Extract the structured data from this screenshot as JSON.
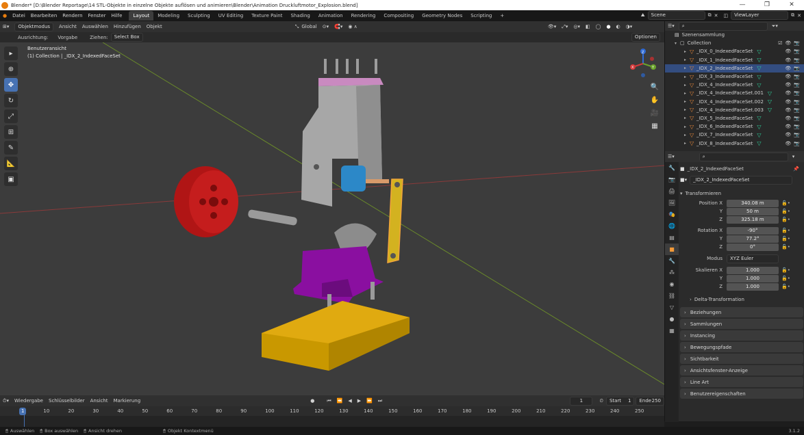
{
  "window": {
    "title": "Blender* [D:\\Blender Reportage\\14 STL-Objekte in einzelne Objekte auflösen und animieren\\Blender\\Animation Druckluftmotor_Explosion.blend]",
    "min_icon": "minimize-icon",
    "max_icon": "maximize-icon",
    "close_icon": "close-icon"
  },
  "menu": {
    "items": [
      "Datei",
      "Bearbeiten",
      "Rendern",
      "Fenster",
      "Hilfe"
    ],
    "workspaces": [
      "Layout",
      "Modeling",
      "Sculpting",
      "UV Editing",
      "Texture Paint",
      "Shading",
      "Animation",
      "Rendering",
      "Compositing",
      "Geometry Nodes",
      "Scripting",
      "+"
    ],
    "active_workspace": "Layout",
    "scene_label": "Scene",
    "viewlayer_label": "ViewLayer"
  },
  "viewport_header": {
    "mode": "Objektmodus",
    "items": [
      "Ansicht",
      "Auswählen",
      "Hinzufügen",
      "Objekt"
    ],
    "transform_orientation": "Global",
    "options": "Optionen"
  },
  "tool_header": {
    "orientation_label": "Ausrichtung:",
    "orientation_value": "Vorgabe",
    "drag_label": "Ziehen:",
    "drag_value": "Select Box"
  },
  "viewport": {
    "view_name": "Benutzeransicht",
    "object_info": "(1) Collection | _IDX_2_IndexedFaceSet",
    "gizmo_axes": [
      "X",
      "Y",
      "Z"
    ]
  },
  "toolbar": {
    "tools": [
      "select-box-icon",
      "cursor-icon",
      "move-icon",
      "rotate-icon",
      "scale-icon",
      "transform-icon",
      "annotate-icon",
      "measure-icon",
      "add-cube-icon"
    ],
    "active_index": 2
  },
  "outliner": {
    "root": "Szenensammlung",
    "collection": "Collection",
    "items": [
      "_IDX_0_IndexedFaceSet",
      "_IDX_1_IndexedFaceSet",
      "_IDX_2_IndexedFaceSet",
      "_IDX_3_IndexedFaceSet",
      "_IDX_4_IndexedFaceSet",
      "_IDX_4_IndexedFaceSet.001",
      "_IDX_4_IndexedFaceSet.002",
      "_IDX_4_IndexedFaceSet.003",
      "_IDX_5_IndexedFaceSet",
      "_IDX_6_IndexedFaceSet",
      "_IDX_7_IndexedFaceSet",
      "_IDX_8_IndexedFaceSet"
    ],
    "selected_index": 2
  },
  "properties": {
    "object_name": "_IDX_2_IndexedFaceSet",
    "object_field": "_IDX_2_IndexedFaceSet",
    "section": "Transformieren",
    "position_label": "Position X",
    "position": [
      "340.08 m",
      "50 m",
      "325.18 m"
    ],
    "rotation_label": "Rotation X",
    "rotation": [
      "-90°",
      "77.2°",
      "0°"
    ],
    "mode_label": "Modus",
    "mode_value": "XYZ Euler",
    "scale_label": "Skalieren X",
    "scale": [
      "1.000",
      "1.000",
      "1.000"
    ],
    "y": "Y",
    "z": "Z",
    "delta": "Delta-Transformation",
    "panels": [
      "Beziehungen",
      "Sammlungen",
      "Instancing",
      "Bewegungspfade",
      "Sichtbarkeit",
      "Ansichtsfenster-Anzeige",
      "Line Art",
      "Benutzereigenschaften"
    ]
  },
  "timeline": {
    "menu": [
      "Wiedergabe",
      "Schlüsselbilder",
      "Ansicht",
      "Markierung"
    ],
    "current_frame": "1",
    "start_label": "Start",
    "start_value": "1",
    "end_label": "Ende",
    "end_value": "250",
    "ticks": [
      "1",
      "10",
      "20",
      "30",
      "40",
      "50",
      "60",
      "70",
      "80",
      "90",
      "100",
      "110",
      "120",
      "130",
      "140",
      "150",
      "160",
      "170",
      "180",
      "190",
      "200",
      "210",
      "220",
      "230",
      "240",
      "250"
    ],
    "playhead": "1"
  },
  "statusbar": {
    "select": "Auswählen",
    "box_select": "Box auswählen",
    "rotate_view": "Ansicht drehen",
    "context_menu": "Objekt Kontextmenü",
    "version": "3.1.2"
  },
  "colors": {
    "accent": "#4772b3",
    "selected_row": "#334d80",
    "object_orange": "#e8883a",
    "mesh_green": "#2dd29c"
  }
}
